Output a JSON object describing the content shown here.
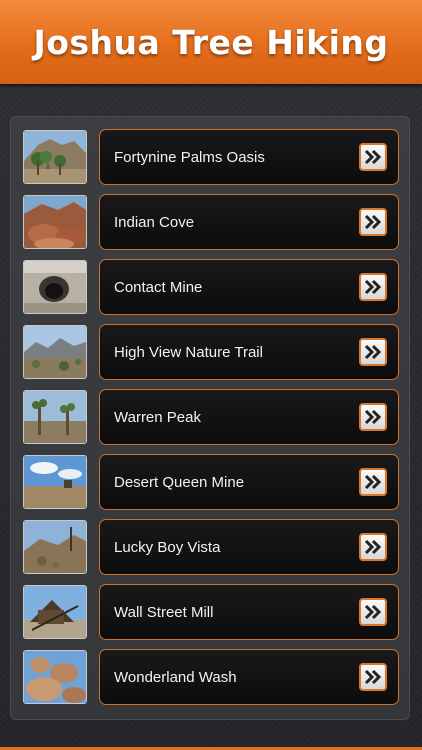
{
  "header": {
    "title": "Joshua Tree Hiking",
    "color": "#e46e1c"
  },
  "trails": [
    {
      "label": "Fortynine Palms Oasis",
      "thumb_icon": "palm-oasis-photo",
      "arrow_icon": "double-chevron-right-icon"
    },
    {
      "label": "Indian Cove",
      "thumb_icon": "red-rocks-photo",
      "arrow_icon": "double-chevron-right-icon"
    },
    {
      "label": "Contact Mine",
      "thumb_icon": "mine-tunnel-photo",
      "arrow_icon": "double-chevron-right-icon"
    },
    {
      "label": "High View Nature Trail",
      "thumb_icon": "mountain-view-photo",
      "arrow_icon": "double-chevron-right-icon"
    },
    {
      "label": "Warren Peak",
      "thumb_icon": "joshua-trees-photo",
      "arrow_icon": "double-chevron-right-icon"
    },
    {
      "label": "Desert Queen Mine",
      "thumb_icon": "desert-sky-photo",
      "arrow_icon": "double-chevron-right-icon"
    },
    {
      "label": "Lucky Boy Vista",
      "thumb_icon": "rocky-hill-photo",
      "arrow_icon": "double-chevron-right-icon"
    },
    {
      "label": "Wall Street Mill",
      "thumb_icon": "old-mill-photo",
      "arrow_icon": "double-chevron-right-icon"
    },
    {
      "label": "Wonderland Wash",
      "thumb_icon": "boulders-photo",
      "arrow_icon": "double-chevron-right-icon"
    }
  ]
}
